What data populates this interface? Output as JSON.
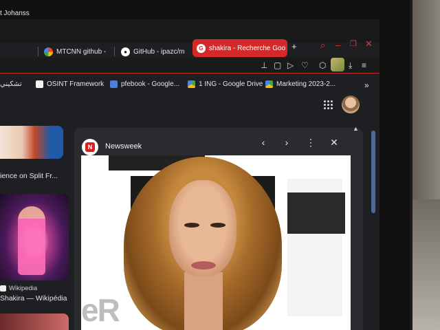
{
  "tabs": [
    {
      "label": "t Johanss",
      "favicon": "generic"
    },
    {
      "label": "MTCNN github -",
      "favicon": "google"
    },
    {
      "label": "GitHub - ipazc/m",
      "favicon": "github"
    },
    {
      "label": "shakira - Recherche Goo",
      "favicon": "google",
      "active": true
    }
  ],
  "window_controls": [
    "search-icon",
    "minimize-icon",
    "restore-icon",
    "close-icon"
  ],
  "new_tab_label": "+",
  "bookmarks": [
    {
      "label": "تشكيني",
      "icon": "generic"
    },
    {
      "label": "OSINT Framework",
      "icon": "doc"
    },
    {
      "label": "pfebook - Google...",
      "icon": "docs"
    },
    {
      "label": "1 ING - Google Drive",
      "icon": "drive"
    },
    {
      "label": "Marketing 2023-2...",
      "icon": "drive"
    }
  ],
  "bookmarks_more": "»",
  "results": {
    "title_1": "ience on Split Fr...",
    "source_2": "Wikipedia",
    "title_2": "Shakira — Wikipédia"
  },
  "preview": {
    "source": "Newsweek",
    "logo_letter": "N",
    "back": "‹",
    "forward": "›",
    "more": "⋮",
    "close": "✕",
    "photo_text": "eR"
  },
  "colors": {
    "accent": "#d62828",
    "background": "#1e1f22"
  }
}
